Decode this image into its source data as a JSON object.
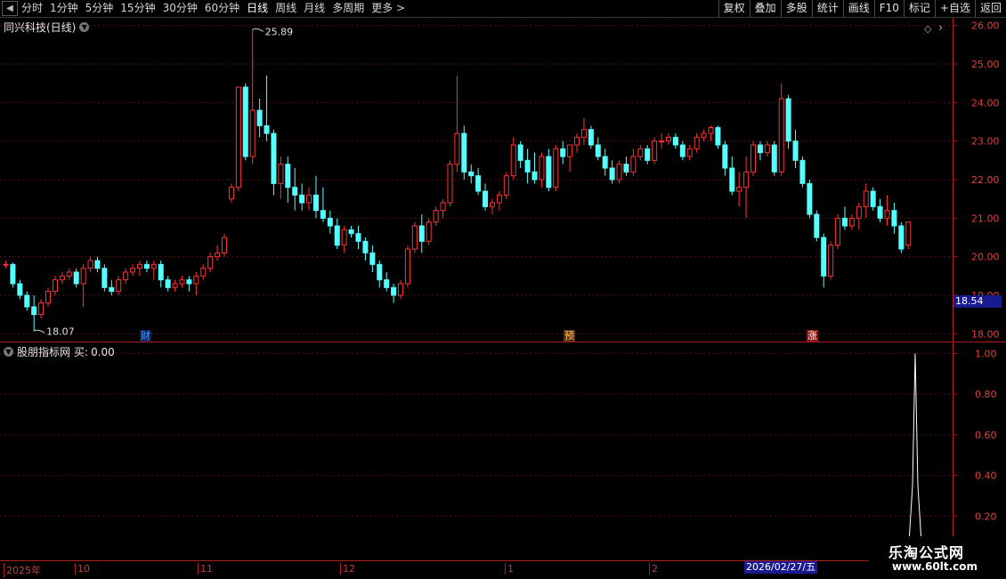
{
  "toolbar": {
    "periods": [
      "分时",
      "1分钟",
      "5分钟",
      "15分钟",
      "30分钟",
      "60分钟",
      "日线",
      "周线",
      "月线",
      "多周期",
      "更多 >"
    ],
    "active_period": "日线",
    "buttons": [
      "复权",
      "叠加",
      "多股",
      "统计",
      "画线",
      "F10",
      "标记",
      "+自选",
      "返回"
    ]
  },
  "price_panel": {
    "stock_title": "同兴科技(日线)",
    "high_label": "25.89",
    "low_label": "18.07",
    "current_price": "18.54",
    "y_ticks": [
      "26.00",
      "25.00",
      "24.00",
      "23.00",
      "22.00",
      "21.00",
      "20.00",
      "19.00",
      "18.00"
    ],
    "markers": [
      {
        "text": "财",
        "color": "#4aa0ff",
        "bg": "#12205a"
      },
      {
        "text": "预",
        "color": "#ffd040",
        "bg": "#5a2a12"
      },
      {
        "text": "涨",
        "color": "#ffffff",
        "bg": "#8a1010"
      }
    ]
  },
  "indicator_panel": {
    "title": "股朋指标网",
    "buy_label": "买:",
    "buy_value": "0.00",
    "y_ticks": [
      "1.00",
      "0.80",
      "0.60",
      "0.40",
      "0.20"
    ]
  },
  "time_axis": {
    "labels": [
      "2025年",
      "10",
      "11",
      "12",
      "1",
      "2"
    ],
    "cursor_date": "2026/02/27/五"
  },
  "watermark": {
    "line1": "乐淘公式网",
    "line2": "www.60lt.com"
  },
  "colors": {
    "up": "#ff3232",
    "down": "#54ffff",
    "grid": "#5a0f0f",
    "axis": "#b02020"
  },
  "chart_data": {
    "type": "candlestick",
    "candles": [
      [
        19.8,
        19.9,
        19.7,
        19.8
      ],
      [
        19.8,
        19.85,
        19.2,
        19.3
      ],
      [
        19.3,
        19.4,
        18.9,
        19.0
      ],
      [
        19.0,
        19.1,
        18.6,
        18.7
      ],
      [
        18.7,
        19.0,
        18.07,
        18.5
      ],
      [
        18.5,
        18.9,
        18.4,
        18.8
      ],
      [
        18.8,
        19.2,
        18.7,
        19.1
      ],
      [
        19.1,
        19.5,
        19.0,
        19.4
      ],
      [
        19.4,
        19.6,
        19.3,
        19.5
      ],
      [
        19.5,
        19.7,
        19.4,
        19.6
      ],
      [
        19.6,
        19.7,
        19.2,
        19.3
      ],
      [
        19.3,
        19.8,
        18.7,
        19.7
      ],
      [
        19.7,
        20.0,
        19.6,
        19.9
      ],
      [
        19.9,
        20.0,
        19.6,
        19.7
      ],
      [
        19.7,
        19.8,
        19.1,
        19.2
      ],
      [
        19.2,
        19.4,
        19.0,
        19.1
      ],
      [
        19.1,
        19.5,
        19.0,
        19.4
      ],
      [
        19.4,
        19.7,
        19.3,
        19.6
      ],
      [
        19.6,
        19.8,
        19.5,
        19.7
      ],
      [
        19.7,
        19.9,
        19.5,
        19.8
      ],
      [
        19.8,
        19.9,
        19.6,
        19.7
      ],
      [
        19.7,
        19.9,
        19.4,
        19.8
      ],
      [
        19.8,
        19.9,
        19.2,
        19.4
      ],
      [
        19.4,
        19.5,
        19.1,
        19.2
      ],
      [
        19.2,
        19.4,
        19.1,
        19.3
      ],
      [
        19.3,
        19.5,
        19.2,
        19.4
      ],
      [
        19.4,
        19.5,
        19.1,
        19.3
      ],
      [
        19.3,
        19.6,
        19.0,
        19.5
      ],
      [
        19.5,
        19.8,
        19.4,
        19.7
      ],
      [
        19.7,
        20.1,
        19.6,
        20.0
      ],
      [
        20.0,
        20.3,
        19.9,
        20.1
      ],
      [
        20.1,
        20.6,
        20.0,
        20.5
      ],
      [
        21.5,
        21.9,
        21.4,
        21.8
      ],
      [
        21.8,
        24.4,
        21.7,
        24.4
      ],
      [
        24.4,
        24.5,
        22.5,
        22.6
      ],
      [
        22.6,
        25.89,
        22.4,
        23.8
      ],
      [
        23.8,
        24.1,
        23.1,
        23.4
      ],
      [
        23.4,
        24.7,
        23.0,
        23.2
      ],
      [
        23.2,
        23.3,
        21.6,
        21.9
      ],
      [
        21.9,
        22.6,
        21.5,
        22.4
      ],
      [
        22.4,
        22.6,
        21.4,
        21.8
      ],
      [
        21.8,
        22.3,
        21.2,
        21.6
      ],
      [
        21.6,
        21.9,
        21.2,
        21.4
      ],
      [
        21.4,
        21.8,
        21.2,
        21.6
      ],
      [
        21.6,
        22.1,
        21.0,
        21.2
      ],
      [
        21.2,
        21.8,
        20.9,
        21.0
      ],
      [
        21.0,
        21.2,
        20.6,
        20.8
      ],
      [
        20.8,
        21.0,
        20.2,
        20.3
      ],
      [
        20.3,
        20.8,
        20.1,
        20.7
      ],
      [
        20.7,
        20.8,
        20.5,
        20.6
      ],
      [
        20.6,
        20.8,
        20.2,
        20.4
      ],
      [
        20.4,
        20.5,
        19.9,
        20.1
      ],
      [
        20.1,
        20.3,
        19.6,
        19.8
      ],
      [
        19.8,
        19.9,
        19.2,
        19.4
      ],
      [
        19.4,
        19.6,
        19.1,
        19.2
      ],
      [
        19.2,
        19.3,
        18.8,
        19.0
      ],
      [
        19.0,
        19.4,
        18.9,
        19.3
      ],
      [
        19.3,
        20.3,
        19.2,
        20.2
      ],
      [
        20.2,
        20.9,
        20.1,
        20.8
      ],
      [
        20.8,
        21.1,
        20.1,
        20.4
      ],
      [
        20.4,
        21.0,
        20.3,
        20.9
      ],
      [
        20.9,
        21.3,
        20.8,
        21.2
      ],
      [
        21.2,
        21.5,
        21.0,
        21.4
      ],
      [
        21.4,
        22.5,
        21.3,
        22.4
      ],
      [
        22.4,
        24.7,
        22.2,
        23.2
      ],
      [
        23.2,
        23.4,
        22.0,
        22.2
      ],
      [
        22.2,
        22.4,
        21.9,
        22.1
      ],
      [
        22.1,
        22.3,
        21.6,
        21.7
      ],
      [
        21.7,
        21.9,
        21.2,
        21.3
      ],
      [
        21.3,
        21.5,
        21.1,
        21.4
      ],
      [
        21.4,
        21.7,
        21.2,
        21.6
      ],
      [
        21.6,
        22.2,
        21.5,
        22.1
      ],
      [
        22.1,
        23.1,
        22.0,
        22.9
      ],
      [
        22.9,
        23.0,
        22.3,
        22.5
      ],
      [
        22.5,
        22.8,
        21.9,
        22.2
      ],
      [
        22.2,
        22.7,
        21.9,
        22.0
      ],
      [
        22.0,
        22.7,
        21.8,
        22.6
      ],
      [
        22.6,
        22.8,
        21.7,
        21.8
      ],
      [
        21.8,
        22.9,
        21.7,
        22.8
      ],
      [
        22.8,
        23.0,
        22.4,
        22.6
      ],
      [
        22.6,
        22.9,
        22.2,
        22.9
      ],
      [
        22.9,
        23.2,
        22.7,
        23.1
      ],
      [
        23.1,
        23.6,
        22.9,
        23.3
      ],
      [
        23.3,
        23.4,
        22.8,
        22.9
      ],
      [
        22.9,
        23.1,
        22.5,
        22.6
      ],
      [
        22.6,
        22.8,
        22.1,
        22.3
      ],
      [
        22.3,
        22.5,
        21.9,
        22.0
      ],
      [
        22.0,
        22.5,
        21.9,
        22.4
      ],
      [
        22.4,
        22.6,
        22.1,
        22.2
      ],
      [
        22.2,
        22.8,
        22.1,
        22.6
      ],
      [
        22.6,
        22.9,
        22.5,
        22.8
      ],
      [
        22.8,
        22.9,
        22.4,
        22.5
      ],
      [
        22.5,
        23.1,
        22.4,
        23.0
      ],
      [
        23.0,
        23.2,
        22.8,
        23.0
      ],
      [
        23.0,
        23.2,
        22.9,
        23.1
      ],
      [
        23.1,
        23.2,
        22.8,
        22.9
      ],
      [
        22.9,
        23.0,
        22.5,
        22.6
      ],
      [
        22.6,
        22.9,
        22.5,
        22.8
      ],
      [
        22.8,
        23.2,
        22.7,
        23.1
      ],
      [
        23.1,
        23.3,
        23.0,
        23.2
      ],
      [
        23.2,
        23.4,
        23.0,
        23.35
      ],
      [
        23.35,
        23.4,
        22.8,
        22.9
      ],
      [
        22.9,
        23.0,
        22.1,
        22.3
      ],
      [
        22.3,
        22.6,
        21.6,
        21.7
      ],
      [
        21.7,
        22.2,
        21.3,
        21.8
      ],
      [
        21.8,
        22.6,
        21.0,
        22.2
      ],
      [
        22.2,
        23.0,
        22.1,
        22.9
      ],
      [
        22.9,
        23.0,
        22.5,
        22.7
      ],
      [
        22.7,
        23.0,
        22.6,
        22.9
      ],
      [
        22.9,
        23.0,
        22.1,
        22.2
      ],
      [
        22.2,
        24.5,
        22.1,
        24.1
      ],
      [
        24.1,
        24.2,
        22.8,
        23.0
      ],
      [
        23.0,
        23.3,
        22.3,
        22.5
      ],
      [
        22.5,
        22.6,
        21.8,
        21.9
      ],
      [
        21.9,
        22.0,
        21.0,
        21.1
      ],
      [
        21.1,
        21.2,
        20.4,
        20.5
      ],
      [
        20.5,
        20.6,
        19.2,
        19.5
      ],
      [
        19.5,
        20.4,
        19.4,
        20.3
      ],
      [
        20.3,
        21.1,
        20.2,
        21.0
      ],
      [
        21.0,
        21.3,
        20.7,
        20.8
      ],
      [
        20.8,
        21.1,
        20.7,
        21.0
      ],
      [
        21.0,
        21.4,
        20.7,
        21.3
      ],
      [
        21.3,
        21.9,
        21.0,
        21.7
      ],
      [
        21.7,
        21.8,
        21.2,
        21.3
      ],
      [
        21.3,
        21.5,
        20.9,
        21.0
      ],
      [
        21.0,
        21.6,
        20.8,
        21.2
      ],
      [
        21.2,
        21.4,
        20.6,
        20.8
      ],
      [
        20.8,
        20.9,
        20.1,
        20.2
      ],
      [
        20.3,
        20.9,
        20.2,
        20.9
      ]
    ],
    "y_range": [
      17.8,
      26.2
    ],
    "indicator_series": {
      "name": "买",
      "peak_value": 1.0,
      "baseline": 0.0,
      "y_range": [
        0,
        1.05
      ]
    }
  }
}
